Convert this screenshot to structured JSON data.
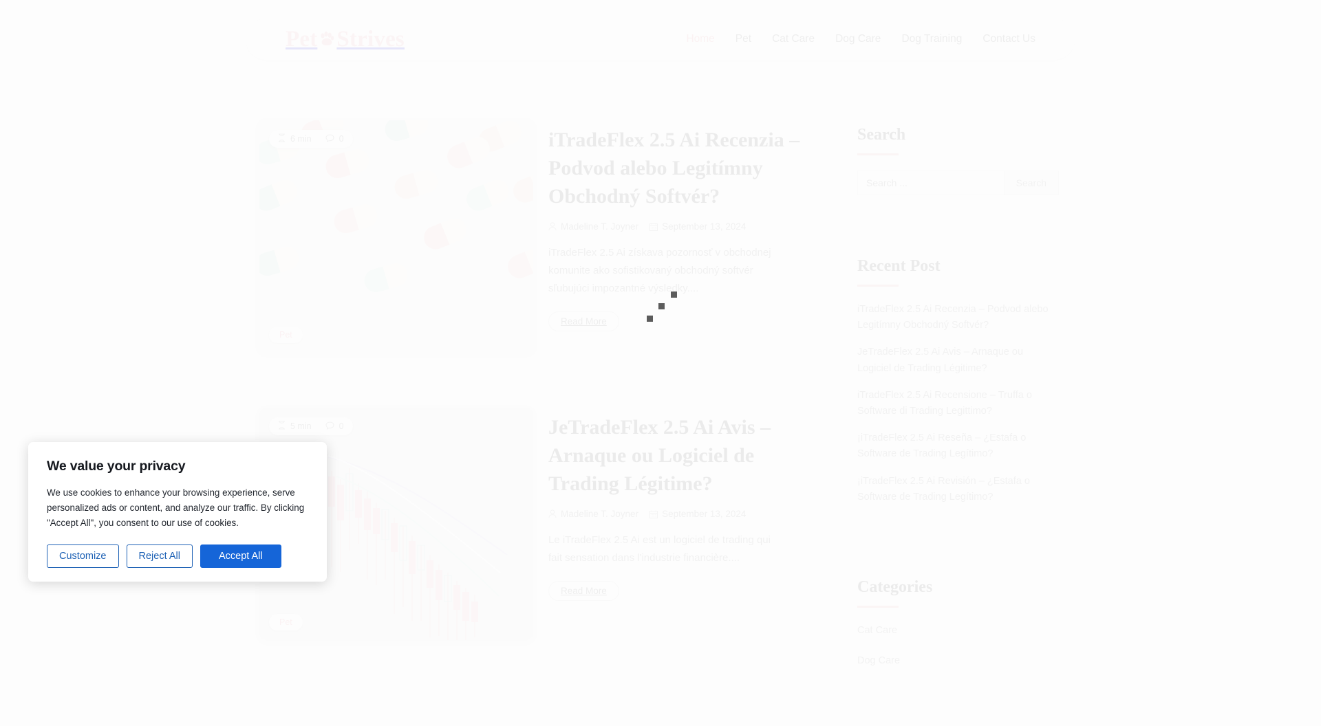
{
  "site": {
    "logo_part1": "Pet",
    "logo_part2": "Strives",
    "logo_icon": "paw-print-icon",
    "brand_color": "#ef8a94"
  },
  "nav": {
    "items": [
      {
        "label": "Home",
        "active": true
      },
      {
        "label": "Pet",
        "active": false
      },
      {
        "label": "Cat Care",
        "active": false
      },
      {
        "label": "Dog Care",
        "active": false
      },
      {
        "label": "Dog Training",
        "active": false
      },
      {
        "label": "Contact Us",
        "active": false
      }
    ]
  },
  "posts": [
    {
      "read_time": "6 min",
      "comments": "0",
      "category": "Pet",
      "title": "iTradeFlex 2.5 Ai Recenzia – Podvod alebo Legitímny Obchodný Softvér?",
      "author": "Madeline T. Joyner",
      "date": "September 13, 2024",
      "excerpt": "iTradeFlex 2.5 Ai získava pozornosť v obchodnej komunite ako sofistikovaný obchodný softvér sľubujúci impozantné výsledky....",
      "read_more": "Read More",
      "thumb_kind": "pills-photo"
    },
    {
      "read_time": "5 min",
      "comments": "0",
      "category": "Pet",
      "title": "JeTradeFlex 2.5 Ai Avis – Arnaque ou Logiciel de Trading Légitime?",
      "author": "Madeline T. Joyner",
      "date": "September 13, 2024",
      "excerpt": "Le iTradeFlex 2.5 Ai est un logiciel de trading qui fait sensation dans l'industrie financière....",
      "read_more": "Read More",
      "thumb_kind": "candlestick-chart"
    }
  ],
  "sidebar": {
    "search": {
      "title": "Search",
      "placeholder": "Search ...",
      "value": "",
      "button_label": "Search"
    },
    "recent": {
      "title": "Recent Post",
      "items": [
        "iTradeFlex 2.5 Ai Recenzia – Podvod alebo Legitímny Obchodný Softvér?",
        "JeTradeFlex 2.5 Ai Avis – Arnaque ou Logiciel de Trading Légitime?",
        "iTradeFlex 2.5 Ai Recensione – Truffa o Software di Trading Legittimo?",
        "¡iTradeFlex 2.5 Ai Reseña – ¿Estafa o Software de Trading Legítimo?",
        "¡iTradeFlex 2.5 Ai Revisión – ¿Estafa o Software de Trading Legítimo?"
      ]
    },
    "categories": {
      "title": "Categories",
      "items": [
        "Cat Care",
        "Dog Care"
      ]
    }
  },
  "cookie_banner": {
    "title": "We value your privacy",
    "body": "We use cookies to enhance your browsing experience, serve personalized ads or content, and analyze our traffic. By clicking \"Accept All\", you consent to our use of cookies.",
    "customize_label": "Customize",
    "reject_label": "Reject All",
    "accept_label": "Accept All",
    "accent_color": "#1565d8"
  }
}
